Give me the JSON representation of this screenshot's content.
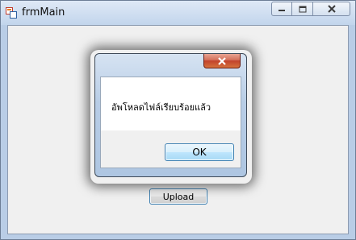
{
  "window": {
    "title": "frmMain",
    "icon": "app-icon",
    "caption_buttons": [
      "minimize-icon",
      "maximize-icon",
      "close-icon"
    ]
  },
  "main": {
    "upload_label": "Upload"
  },
  "message_box": {
    "text": "อัพโหลดไฟล์เรียบร้อยแล้ว",
    "ok_label": "OK",
    "close_icon": "close-icon"
  },
  "colors": {
    "accent_border": "#3c7fb1",
    "close_red": "#c2412b",
    "client_bg": "#f0f0f0"
  }
}
